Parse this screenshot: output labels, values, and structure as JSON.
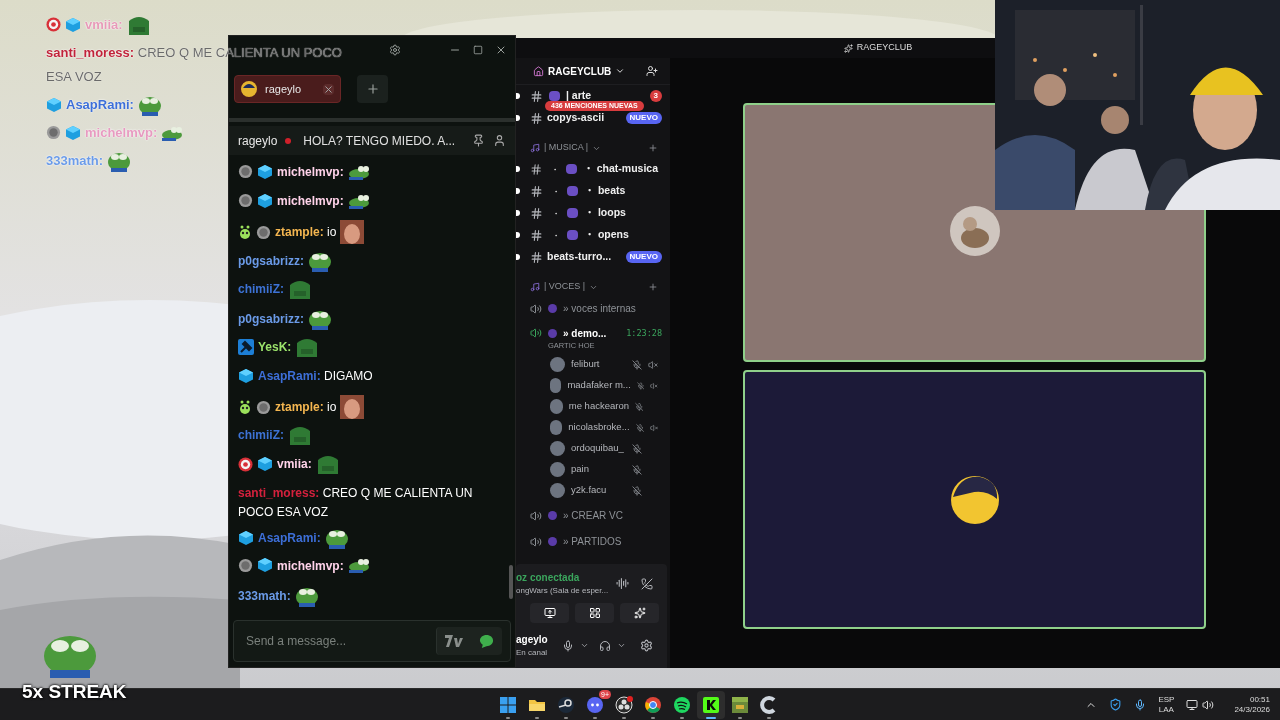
{
  "overlay_chat": {
    "messages": [
      {
        "badges": [
          {
            "kind": "target"
          },
          {
            "kind": "cube"
          }
        ],
        "user": "vmiia:",
        "color": "#e79ab8",
        "emote": {
          "kind": "block"
        }
      },
      {
        "user": "santi_moress:",
        "color": "#c0233a",
        "text": "CREO Q ME CALIENTA UN POCO ESA VOZ"
      },
      {
        "badges": [
          {
            "kind": "cube"
          }
        ],
        "user": "AsapRami:",
        "color": "#3d6fd8",
        "emote": {
          "kind": "frog"
        }
      },
      {
        "badges": [
          {
            "kind": "gray"
          },
          {
            "kind": "cube"
          }
        ],
        "user": "michelmvp:",
        "color": "#e79ac0",
        "emote": {
          "kind": "frog-small"
        }
      },
      {
        "user": "333math:",
        "color": "#6b9be8",
        "emote": {
          "kind": "frog"
        }
      }
    ]
  },
  "streak": {
    "text": "5x STREAK"
  },
  "chat_window": {
    "tabs": [
      {
        "label": "rageylo",
        "selected": true
      }
    ],
    "header": {
      "channel": "rageylo",
      "live": true,
      "title": "HOLA? TENGO MIEDO. A..."
    },
    "messages": [
      {
        "badges": [
          {
            "kind": "gray"
          },
          {
            "kind": "cube"
          }
        ],
        "user": "michelmvp:",
        "color": "#ffd3ea",
        "emote": {
          "kind": "frog-small"
        }
      },
      {
        "badges": [
          {
            "kind": "gray"
          },
          {
            "kind": "cube"
          }
        ],
        "user": "michelmvp:",
        "color": "#ffd3ea",
        "emote": {
          "kind": "frog-small"
        }
      },
      {
        "badges": [
          {
            "kind": "alien"
          },
          {
            "kind": "gray"
          }
        ],
        "user": "ztample:",
        "color": "#f4b650",
        "text": "io",
        "emote": {
          "kind": "face"
        }
      },
      {
        "user": "p0gsabrizz:",
        "color": "#6b9be8",
        "emote": {
          "kind": "frog"
        }
      },
      {
        "user": "chimiiZ:",
        "color": "#3d73d6",
        "emote": {
          "kind": "block"
        }
      },
      {
        "user": "p0gsabrizz:",
        "color": "#6b9be8",
        "emote": {
          "kind": "frog"
        }
      },
      {
        "badges": [
          {
            "kind": "hammer"
          }
        ],
        "user": "YesK:",
        "color": "#9be36b",
        "emote": {
          "kind": "block"
        }
      },
      {
        "badges": [
          {
            "kind": "cube"
          }
        ],
        "user": "AsapRami:",
        "color": "#3d6fd8",
        "text": "DIGAMO"
      },
      {
        "badges": [
          {
            "kind": "alien"
          },
          {
            "kind": "gray"
          }
        ],
        "user": "ztample:",
        "color": "#f4b650",
        "text": "io",
        "emote": {
          "kind": "face"
        }
      },
      {
        "user": "chimiiZ:",
        "color": "#3d73d6",
        "emote": {
          "kind": "block"
        }
      },
      {
        "badges": [
          {
            "kind": "target"
          },
          {
            "kind": "cube"
          }
        ],
        "user": "vmiia:",
        "color": "#ffd3ea",
        "emote": {
          "kind": "block"
        }
      },
      {
        "user": "santi_moress:",
        "color": "#d4213d",
        "text": "CREO Q ME CALIENTA UN POCO ESA VOZ"
      },
      {
        "badges": [
          {
            "kind": "cube"
          }
        ],
        "user": "AsapRami:",
        "color": "#3d6fd8",
        "emote": {
          "kind": "frog"
        }
      },
      {
        "badges": [
          {
            "kind": "gray"
          },
          {
            "kind": "cube"
          }
        ],
        "user": "michelmvp:",
        "color": "#ffd3ea",
        "emote": {
          "kind": "frog-small"
        }
      },
      {
        "user": "333math:",
        "color": "#6b9be8",
        "emote": {
          "kind": "frog"
        }
      }
    ],
    "input": {
      "placeholder": "Send a message..."
    }
  },
  "discord": {
    "window_title": "RAGEYCLUB",
    "server": "RAGEYCLUB",
    "mentions": "436 MENCIONES NUEVAS",
    "sidebar": [
      {
        "kind": "channel",
        "name": "| arte",
        "unread": true,
        "emoji": true,
        "badge": "3"
      },
      {
        "kind": "channel",
        "name": "copys-ascii",
        "unread": true,
        "emoji": false,
        "badge": "NUEVO"
      },
      {
        "kind": "category",
        "name": "| MUSICA |"
      },
      {
        "kind": "channel",
        "lead": "・",
        "name": "・ chat-musica",
        "unread": true,
        "emoji": true
      },
      {
        "kind": "channel",
        "lead": "・",
        "name": "・ beats",
        "unread": true,
        "emoji": true
      },
      {
        "kind": "channel",
        "lead": "・",
        "name": "・ loops",
        "unread": true,
        "emoji": true
      },
      {
        "kind": "channel",
        "lead": "・",
        "name": "・ opens",
        "unread": true,
        "emoji": true
      },
      {
        "kind": "channel",
        "name": "beats-turro...",
        "unread": true,
        "emoji": false,
        "badge": "NUEVO"
      },
      {
        "kind": "category",
        "name": "| VOCES |"
      },
      {
        "kind": "voice",
        "name": "» voces internas",
        "active": false
      },
      {
        "kind": "voice",
        "name": "» demo...",
        "active": true,
        "timer": "1:23:28",
        "subtitle": "GARTIC HOE"
      },
      {
        "kind": "member",
        "name": "feliburt",
        "muted": true,
        "deafened": true
      },
      {
        "kind": "member",
        "name": "madafaker m...",
        "muted": true,
        "deafened": true
      },
      {
        "kind": "member",
        "name": "me hackearon",
        "muted": true,
        "deafened": false
      },
      {
        "kind": "member",
        "name": "nicolasbroke...",
        "muted": true,
        "deafened": true
      },
      {
        "kind": "member",
        "name": "ordoquibau_",
        "muted": true,
        "deafened": false
      },
      {
        "kind": "member",
        "name": "pain",
        "muted": true,
        "deafened": false
      },
      {
        "kind": "member",
        "name": "y2k.facu",
        "muted": true,
        "deafened": false
      },
      {
        "kind": "voice",
        "name": "» CREAR VC",
        "active": false
      },
      {
        "kind": "voice",
        "name": "» PARTIDOS",
        "active": false
      }
    ],
    "voice_panel": {
      "status": "oz conectada",
      "channel": "ongWars (Sala de esper..."
    },
    "user_panel": {
      "name": "ageylo",
      "status": "En canal"
    }
  },
  "taskbar": {
    "apps": [
      {
        "kind": "windows",
        "selected": false
      },
      {
        "kind": "folder",
        "selected": false
      },
      {
        "kind": "steam",
        "selected": false
      },
      {
        "kind": "discord",
        "selected": false,
        "badge": "9+"
      },
      {
        "kind": "obs",
        "selected": false
      },
      {
        "kind": "chrome",
        "selected": false
      },
      {
        "kind": "spotify",
        "selected": false
      },
      {
        "kind": "kick",
        "selected": true
      },
      {
        "kind": "game",
        "selected": false
      },
      {
        "kind": "cleaner",
        "selected": false
      }
    ],
    "language": "ESP",
    "layout": "LAA",
    "time": "00:51",
    "date": "24/3/2026"
  }
}
